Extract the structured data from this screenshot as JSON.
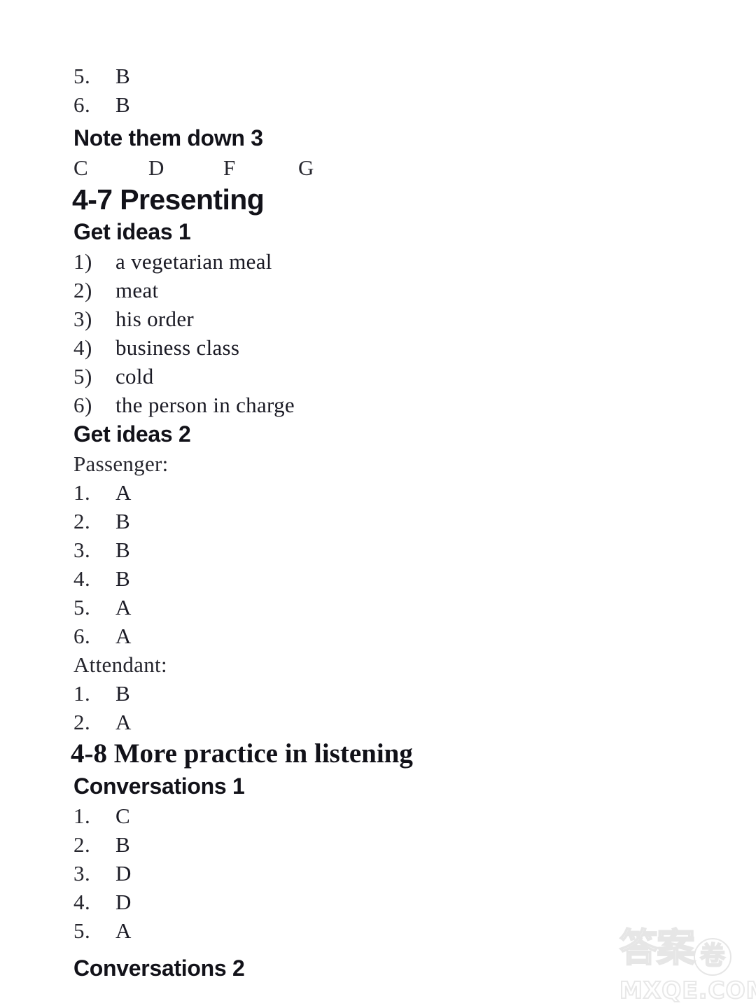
{
  "page": {
    "background_color": "#ffffff",
    "text_color": "#1a1a24"
  },
  "blocks": [
    {
      "type": "numbered",
      "number": "5.",
      "value": "B"
    },
    {
      "type": "numbered",
      "number": "6.",
      "value": "B"
    }
  ],
  "note_them_down": {
    "heading": "Note them down 3",
    "answers": [
      "C",
      "D",
      "F",
      "G"
    ]
  },
  "section_4_7": {
    "heading": "4-7 Presenting",
    "get_ideas_1": {
      "heading": "Get ideas 1",
      "items": [
        {
          "number": "1)",
          "value": "a vegetarian meal"
        },
        {
          "number": "2)",
          "value": "meat"
        },
        {
          "number": "3)",
          "value": "his order"
        },
        {
          "number": "4)",
          "value": "business class"
        },
        {
          "number": "5)",
          "value": "cold"
        },
        {
          "number": "6)",
          "value": "the person in charge"
        }
      ]
    },
    "get_ideas_2": {
      "heading": "Get ideas 2",
      "passenger_label": "Passenger:",
      "passenger_items": [
        {
          "number": "1.",
          "value": "A"
        },
        {
          "number": "2.",
          "value": "B"
        },
        {
          "number": "3.",
          "value": "B"
        },
        {
          "number": "4.",
          "value": "B"
        },
        {
          "number": "5.",
          "value": "A"
        },
        {
          "number": "6.",
          "value": "A"
        }
      ],
      "attendant_label": "Attendant:",
      "attendant_items": [
        {
          "number": "1.",
          "value": "B"
        },
        {
          "number": "2.",
          "value": "A"
        }
      ]
    }
  },
  "section_4_8": {
    "heading": "4-8 More practice in listening",
    "conversations_1": {
      "heading": "Conversations 1",
      "items": [
        {
          "number": "1.",
          "value": "C"
        },
        {
          "number": "2.",
          "value": "B"
        },
        {
          "number": "3.",
          "value": "D"
        },
        {
          "number": "4.",
          "value": "D"
        },
        {
          "number": "5.",
          "value": "A"
        }
      ]
    },
    "conversations_2": {
      "heading": "Conversations 2"
    }
  },
  "watermark": {
    "chinese": "答案",
    "circled_char": "卷",
    "domain": "MXQE.COM",
    "color": "#e8e8e8"
  }
}
